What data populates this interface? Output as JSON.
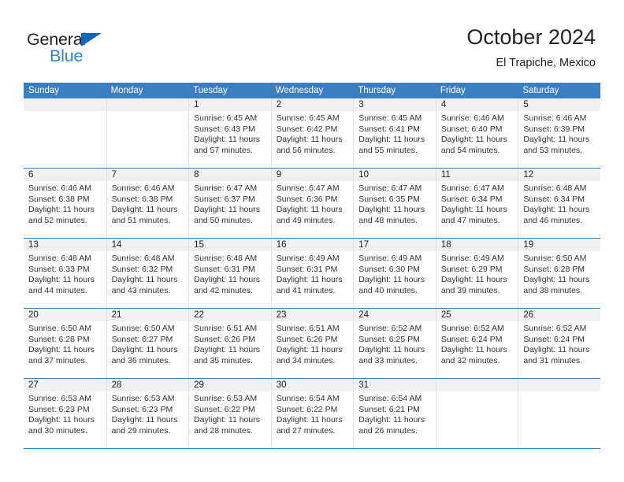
{
  "brand": {
    "name_top": "General",
    "name_bottom": "Blue",
    "color_dark": "#231f20",
    "color_blue": "#2a84d2",
    "triangle_color": "#1565b8"
  },
  "header": {
    "title": "October 2024",
    "subtitle": "El Trapiche, Mexico"
  },
  "theme": {
    "header_bar": "#3a7fc1",
    "daynum_band": "#f0f0f0",
    "separator": "#3a7fc1",
    "cell_border": "#e2e2e2"
  },
  "weekdays": [
    "Sunday",
    "Monday",
    "Tuesday",
    "Wednesday",
    "Thursday",
    "Friday",
    "Saturday"
  ],
  "labels": {
    "sunrise_prefix": "Sunrise:",
    "sunset_prefix": "Sunset:",
    "daylight_prefix": "Daylight:"
  },
  "weeks": [
    [
      {
        "day": "",
        "sunrise": "",
        "sunset": "",
        "daylight_1": "",
        "daylight_2": ""
      },
      {
        "day": "",
        "sunrise": "",
        "sunset": "",
        "daylight_1": "",
        "daylight_2": ""
      },
      {
        "day": "1",
        "sunrise": "Sunrise: 6:45 AM",
        "sunset": "Sunset: 6:43 PM",
        "daylight_1": "Daylight: 11 hours",
        "daylight_2": "and 57 minutes."
      },
      {
        "day": "2",
        "sunrise": "Sunrise: 6:45 AM",
        "sunset": "Sunset: 6:42 PM",
        "daylight_1": "Daylight: 11 hours",
        "daylight_2": "and 56 minutes."
      },
      {
        "day": "3",
        "sunrise": "Sunrise: 6:45 AM",
        "sunset": "Sunset: 6:41 PM",
        "daylight_1": "Daylight: 11 hours",
        "daylight_2": "and 55 minutes."
      },
      {
        "day": "4",
        "sunrise": "Sunrise: 6:46 AM",
        "sunset": "Sunset: 6:40 PM",
        "daylight_1": "Daylight: 11 hours",
        "daylight_2": "and 54 minutes."
      },
      {
        "day": "5",
        "sunrise": "Sunrise: 6:46 AM",
        "sunset": "Sunset: 6:39 PM",
        "daylight_1": "Daylight: 11 hours",
        "daylight_2": "and 53 minutes."
      }
    ],
    [
      {
        "day": "6",
        "sunrise": "Sunrise: 6:46 AM",
        "sunset": "Sunset: 6:38 PM",
        "daylight_1": "Daylight: 11 hours",
        "daylight_2": "and 52 minutes."
      },
      {
        "day": "7",
        "sunrise": "Sunrise: 6:46 AM",
        "sunset": "Sunset: 6:38 PM",
        "daylight_1": "Daylight: 11 hours",
        "daylight_2": "and 51 minutes."
      },
      {
        "day": "8",
        "sunrise": "Sunrise: 6:47 AM",
        "sunset": "Sunset: 6:37 PM",
        "daylight_1": "Daylight: 11 hours",
        "daylight_2": "and 50 minutes."
      },
      {
        "day": "9",
        "sunrise": "Sunrise: 6:47 AM",
        "sunset": "Sunset: 6:36 PM",
        "daylight_1": "Daylight: 11 hours",
        "daylight_2": "and 49 minutes."
      },
      {
        "day": "10",
        "sunrise": "Sunrise: 6:47 AM",
        "sunset": "Sunset: 6:35 PM",
        "daylight_1": "Daylight: 11 hours",
        "daylight_2": "and 48 minutes."
      },
      {
        "day": "11",
        "sunrise": "Sunrise: 6:47 AM",
        "sunset": "Sunset: 6:34 PM",
        "daylight_1": "Daylight: 11 hours",
        "daylight_2": "and 47 minutes."
      },
      {
        "day": "12",
        "sunrise": "Sunrise: 6:48 AM",
        "sunset": "Sunset: 6:34 PM",
        "daylight_1": "Daylight: 11 hours",
        "daylight_2": "and 46 minutes."
      }
    ],
    [
      {
        "day": "13",
        "sunrise": "Sunrise: 6:48 AM",
        "sunset": "Sunset: 6:33 PM",
        "daylight_1": "Daylight: 11 hours",
        "daylight_2": "and 44 minutes."
      },
      {
        "day": "14",
        "sunrise": "Sunrise: 6:48 AM",
        "sunset": "Sunset: 6:32 PM",
        "daylight_1": "Daylight: 11 hours",
        "daylight_2": "and 43 minutes."
      },
      {
        "day": "15",
        "sunrise": "Sunrise: 6:48 AM",
        "sunset": "Sunset: 6:31 PM",
        "daylight_1": "Daylight: 11 hours",
        "daylight_2": "and 42 minutes."
      },
      {
        "day": "16",
        "sunrise": "Sunrise: 6:49 AM",
        "sunset": "Sunset: 6:31 PM",
        "daylight_1": "Daylight: 11 hours",
        "daylight_2": "and 41 minutes."
      },
      {
        "day": "17",
        "sunrise": "Sunrise: 6:49 AM",
        "sunset": "Sunset: 6:30 PM",
        "daylight_1": "Daylight: 11 hours",
        "daylight_2": "and 40 minutes."
      },
      {
        "day": "18",
        "sunrise": "Sunrise: 6:49 AM",
        "sunset": "Sunset: 6:29 PM",
        "daylight_1": "Daylight: 11 hours",
        "daylight_2": "and 39 minutes."
      },
      {
        "day": "19",
        "sunrise": "Sunrise: 6:50 AM",
        "sunset": "Sunset: 6:28 PM",
        "daylight_1": "Daylight: 11 hours",
        "daylight_2": "and 38 minutes."
      }
    ],
    [
      {
        "day": "20",
        "sunrise": "Sunrise: 6:50 AM",
        "sunset": "Sunset: 6:28 PM",
        "daylight_1": "Daylight: 11 hours",
        "daylight_2": "and 37 minutes."
      },
      {
        "day": "21",
        "sunrise": "Sunrise: 6:50 AM",
        "sunset": "Sunset: 6:27 PM",
        "daylight_1": "Daylight: 11 hours",
        "daylight_2": "and 36 minutes."
      },
      {
        "day": "22",
        "sunrise": "Sunrise: 6:51 AM",
        "sunset": "Sunset: 6:26 PM",
        "daylight_1": "Daylight: 11 hours",
        "daylight_2": "and 35 minutes."
      },
      {
        "day": "23",
        "sunrise": "Sunrise: 6:51 AM",
        "sunset": "Sunset: 6:26 PM",
        "daylight_1": "Daylight: 11 hours",
        "daylight_2": "and 34 minutes."
      },
      {
        "day": "24",
        "sunrise": "Sunrise: 6:52 AM",
        "sunset": "Sunset: 6:25 PM",
        "daylight_1": "Daylight: 11 hours",
        "daylight_2": "and 33 minutes."
      },
      {
        "day": "25",
        "sunrise": "Sunrise: 6:52 AM",
        "sunset": "Sunset: 6:24 PM",
        "daylight_1": "Daylight: 11 hours",
        "daylight_2": "and 32 minutes."
      },
      {
        "day": "26",
        "sunrise": "Sunrise: 6:52 AM",
        "sunset": "Sunset: 6:24 PM",
        "daylight_1": "Daylight: 11 hours",
        "daylight_2": "and 31 minutes."
      }
    ],
    [
      {
        "day": "27",
        "sunrise": "Sunrise: 6:53 AM",
        "sunset": "Sunset: 6:23 PM",
        "daylight_1": "Daylight: 11 hours",
        "daylight_2": "and 30 minutes."
      },
      {
        "day": "28",
        "sunrise": "Sunrise: 6:53 AM",
        "sunset": "Sunset: 6:23 PM",
        "daylight_1": "Daylight: 11 hours",
        "daylight_2": "and 29 minutes."
      },
      {
        "day": "29",
        "sunrise": "Sunrise: 6:53 AM",
        "sunset": "Sunset: 6:22 PM",
        "daylight_1": "Daylight: 11 hours",
        "daylight_2": "and 28 minutes."
      },
      {
        "day": "30",
        "sunrise": "Sunrise: 6:54 AM",
        "sunset": "Sunset: 6:22 PM",
        "daylight_1": "Daylight: 11 hours",
        "daylight_2": "and 27 minutes."
      },
      {
        "day": "31",
        "sunrise": "Sunrise: 6:54 AM",
        "sunset": "Sunset: 6:21 PM",
        "daylight_1": "Daylight: 11 hours",
        "daylight_2": "and 26 minutes."
      },
      {
        "day": "",
        "sunrise": "",
        "sunset": "",
        "daylight_1": "",
        "daylight_2": ""
      },
      {
        "day": "",
        "sunrise": "",
        "sunset": "",
        "daylight_1": "",
        "daylight_2": ""
      }
    ]
  ]
}
